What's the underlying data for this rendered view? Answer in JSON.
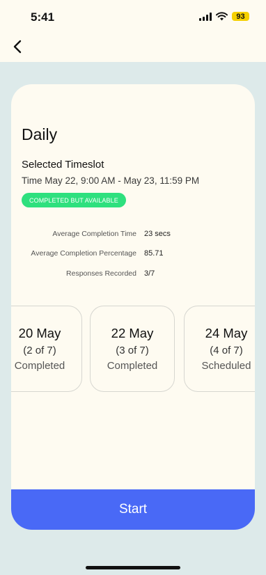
{
  "status_bar": {
    "time": "5:41",
    "battery": "93",
    "battery_color": "#f5d000"
  },
  "nav": {
    "back_icon": "chevron-left-icon"
  },
  "card": {
    "title": "Daily",
    "timeslot_heading": "Selected Timeslot",
    "timeslot_range": "Time May 22, 9:00 AM - May 23, 11:59 PM",
    "status_badge": "COMPLETED BUT AVAILABLE",
    "status_badge_color": "#2ee07e",
    "stats": [
      {
        "label": "Average Completion Time",
        "value": "23 secs"
      },
      {
        "label": "Average Completion Percentage",
        "value": "85.71"
      },
      {
        "label": "Responses Recorded",
        "value": "3/7"
      }
    ],
    "slots": [
      {
        "date": "20 May",
        "num": "(2 of 7)",
        "status": "Completed"
      },
      {
        "date": "22 May",
        "num": "(3 of 7)",
        "status": "Completed"
      },
      {
        "date": "24 May",
        "num": "(4 of 7)",
        "status": "Scheduled"
      }
    ],
    "start_label": "Start",
    "start_color": "#4969f6"
  }
}
